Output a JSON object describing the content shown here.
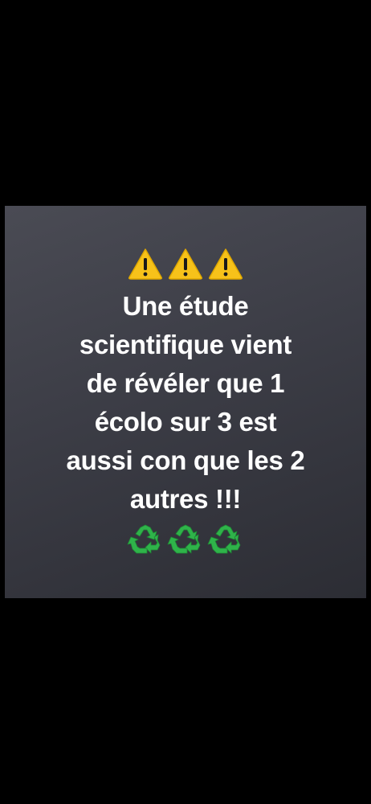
{
  "card": {
    "warning_icons": [
      "warning-icon",
      "warning-icon",
      "warning-icon"
    ],
    "lines": [
      "Une étude",
      "scientifique vient",
      "de révéler que 1",
      "écolo sur 3 est",
      "aussi con que les 2",
      "autres !!!"
    ],
    "recycle_icons": [
      "recycle-icon",
      "recycle-icon",
      "recycle-icon"
    ],
    "colors": {
      "warning_fill": "#f7c21a",
      "warning_glyph": "#1a1a1a",
      "recycle_green": "#2fb34a",
      "text": "#ffffff",
      "background": "#000000"
    }
  }
}
